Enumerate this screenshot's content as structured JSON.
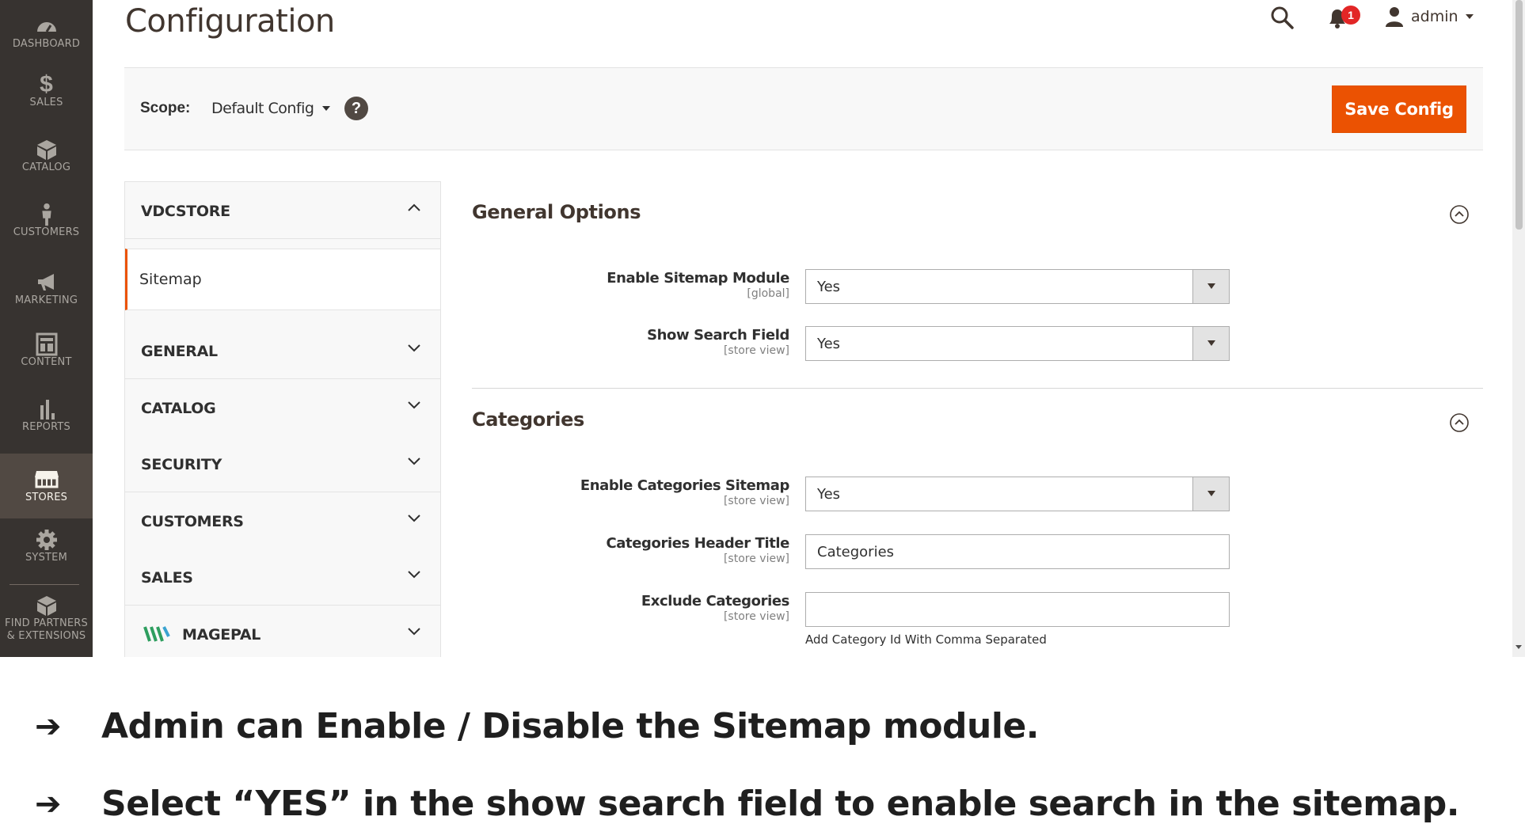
{
  "page_title": "Configuration",
  "admin_menu": [
    {
      "label": "DASHBOARD",
      "icon": "dashboard-icon"
    },
    {
      "label": "SALES",
      "icon": "dollar-icon"
    },
    {
      "label": "CATALOG",
      "icon": "box-icon"
    },
    {
      "label": "CUSTOMERS",
      "icon": "person-icon"
    },
    {
      "label": "MARKETING",
      "icon": "megaphone-icon"
    },
    {
      "label": "CONTENT",
      "icon": "layout-icon"
    },
    {
      "label": "REPORTS",
      "icon": "bar-chart-icon"
    },
    {
      "label": "STORES",
      "icon": "store-icon",
      "active": true
    },
    {
      "label": "SYSTEM",
      "icon": "gear-icon"
    },
    {
      "label_line1": "FIND PARTNERS",
      "label_line2": "& EXTENSIONS",
      "icon": "cube-icon"
    }
  ],
  "header": {
    "notification_count": "1",
    "user_name": "admin"
  },
  "scope": {
    "label": "Scope:",
    "value": "Default Config",
    "help_glyph": "?"
  },
  "actions": {
    "save_label": "Save Config"
  },
  "tabs": {
    "vdcstore": "VDCSTORE",
    "sitemap": "Sitemap",
    "general": "GENERAL",
    "catalog": "CATALOG",
    "security": "SECURITY",
    "customers": "CUSTOMERS",
    "sales": "SALES",
    "magepal": "MAGEPAL"
  },
  "sections": {
    "general_options": {
      "title": "General Options",
      "fields": [
        {
          "label": "Enable Sitemap Module",
          "scope": "[global]",
          "value": "Yes"
        },
        {
          "label": "Show Search Field",
          "scope": "[store view]",
          "value": "Yes"
        }
      ]
    },
    "categories": {
      "title": "Categories",
      "fields": [
        {
          "label": "Enable Categories Sitemap",
          "scope": "[store view]",
          "value": "Yes"
        },
        {
          "label": "Categories Header Title",
          "scope": "[store view]",
          "value": "Categories"
        },
        {
          "label": "Exclude Categories",
          "scope": "[store view]",
          "value": "",
          "note": "Add Category Id With Comma Separated"
        }
      ]
    }
  },
  "notes": [
    "Admin can Enable / Disable the Sitemap module.",
    "Select “YES” in the show search field to enable search in the sitemap."
  ],
  "colors": {
    "sidebar_bg": "#373330",
    "sidebar_active": "#514943",
    "accent": "#eb5202",
    "badge": "#e22626"
  }
}
